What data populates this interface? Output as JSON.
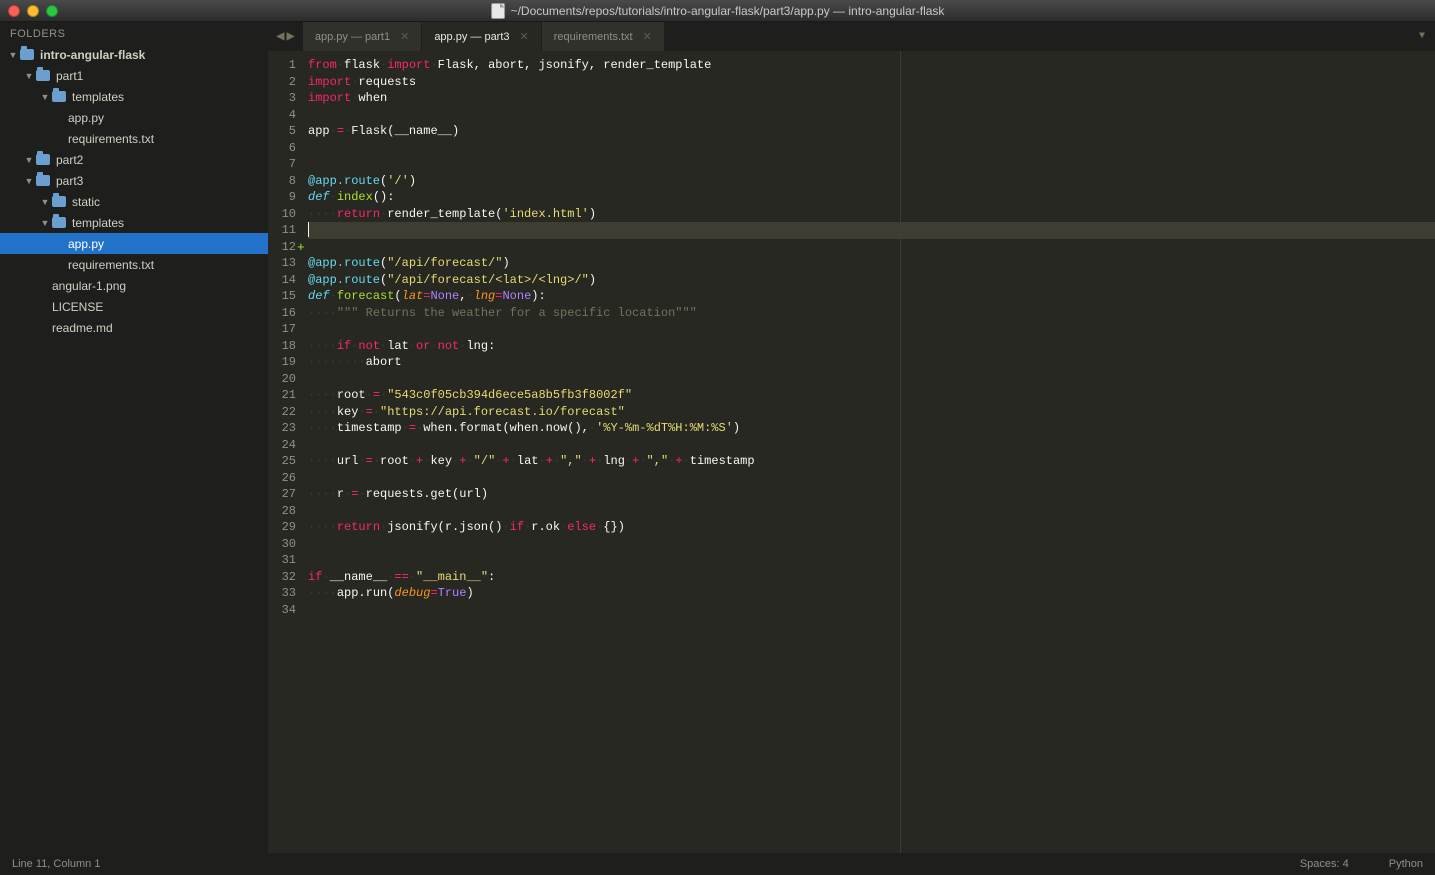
{
  "window": {
    "title": "~/Documents/repos/tutorials/intro-angular-flask/part3/app.py — intro-angular-flask"
  },
  "sidebar": {
    "header": "FOLDERS",
    "tree": [
      {
        "depth": 0,
        "type": "folder",
        "label": "intro-angular-flask",
        "bold": true
      },
      {
        "depth": 1,
        "type": "folder",
        "label": "part1"
      },
      {
        "depth": 2,
        "type": "folder",
        "label": "templates"
      },
      {
        "depth": 2,
        "type": "file",
        "label": "app.py"
      },
      {
        "depth": 2,
        "type": "file",
        "label": "requirements.txt"
      },
      {
        "depth": 1,
        "type": "folder",
        "label": "part2"
      },
      {
        "depth": 1,
        "type": "folder",
        "label": "part3"
      },
      {
        "depth": 2,
        "type": "folder",
        "label": "static"
      },
      {
        "depth": 2,
        "type": "folder",
        "label": "templates"
      },
      {
        "depth": 2,
        "type": "file",
        "label": "app.py",
        "selected": true
      },
      {
        "depth": 2,
        "type": "file",
        "label": "requirements.txt"
      },
      {
        "depth": 1,
        "type": "file",
        "label": "angular-1.png"
      },
      {
        "depth": 1,
        "type": "file",
        "label": "LICENSE"
      },
      {
        "depth": 1,
        "type": "file",
        "label": "readme.md"
      }
    ]
  },
  "tabs": [
    {
      "label": "app.py — part1",
      "active": false
    },
    {
      "label": "app.py — part3",
      "active": true
    },
    {
      "label": "requirements.txt",
      "active": false
    }
  ],
  "editor": {
    "highlighted_line": 11,
    "dirty_marker_line": 12,
    "lines": [
      [
        {
          "t": "from",
          "c": "kw"
        },
        {
          "t": " ",
          "c": "dots"
        },
        {
          "t": "flask",
          "c": "id"
        },
        {
          "t": " ",
          "c": "dots"
        },
        {
          "t": "import",
          "c": "kw"
        },
        {
          "t": " ",
          "c": "dots"
        },
        {
          "t": "Flask, abort, jsonify, render_template",
          "c": "id"
        }
      ],
      [
        {
          "t": "import",
          "c": "kw"
        },
        {
          "t": " ",
          "c": "dots"
        },
        {
          "t": "requests",
          "c": "id"
        }
      ],
      [
        {
          "t": "import",
          "c": "kw"
        },
        {
          "t": " ",
          "c": "dots"
        },
        {
          "t": "when",
          "c": "id"
        }
      ],
      [],
      [
        {
          "t": "app",
          "c": "id"
        },
        {
          "t": " ",
          "c": "dots"
        },
        {
          "t": "=",
          "c": "op"
        },
        {
          "t": " ",
          "c": "dots"
        },
        {
          "t": "Flask(",
          "c": "id"
        },
        {
          "t": "__name__",
          "c": "id"
        },
        {
          "t": ")",
          "c": "id"
        }
      ],
      [],
      [],
      [
        {
          "t": "@app.route",
          "c": "deco"
        },
        {
          "t": "(",
          "c": "id"
        },
        {
          "t": "'/'",
          "c": "decoarg"
        },
        {
          "t": ")",
          "c": "id"
        }
      ],
      [
        {
          "t": "def",
          "c": "fn"
        },
        {
          "t": " ",
          "c": "dots"
        },
        {
          "t": "index",
          "c": "fnname"
        },
        {
          "t": "():",
          "c": "id"
        }
      ],
      [
        {
          "t": "····",
          "c": "dots"
        },
        {
          "t": "return",
          "c": "kw"
        },
        {
          "t": " ",
          "c": "dots"
        },
        {
          "t": "render_template(",
          "c": "id"
        },
        {
          "t": "'index.html'",
          "c": "str"
        },
        {
          "t": ")",
          "c": "id"
        }
      ],
      [
        {
          "t": "",
          "c": "cursor-here"
        }
      ],
      [],
      [
        {
          "t": "@app.route",
          "c": "deco"
        },
        {
          "t": "(",
          "c": "id"
        },
        {
          "t": "\"/api/forecast/\"",
          "c": "decoarg"
        },
        {
          "t": ")",
          "c": "id"
        }
      ],
      [
        {
          "t": "@app.route",
          "c": "deco"
        },
        {
          "t": "(",
          "c": "id"
        },
        {
          "t": "\"/api/forecast/<lat>/<lng>/\"",
          "c": "decoarg"
        },
        {
          "t": ")",
          "c": "id"
        }
      ],
      [
        {
          "t": "def",
          "c": "fn"
        },
        {
          "t": " ",
          "c": "dots"
        },
        {
          "t": "forecast",
          "c": "fnname"
        },
        {
          "t": "(",
          "c": "id"
        },
        {
          "t": "lat",
          "c": "param"
        },
        {
          "t": "=",
          "c": "op"
        },
        {
          "t": "None",
          "c": "const"
        },
        {
          "t": ",",
          "c": "id"
        },
        {
          "t": " ",
          "c": "dots"
        },
        {
          "t": "lng",
          "c": "param"
        },
        {
          "t": "=",
          "c": "op"
        },
        {
          "t": "None",
          "c": "const"
        },
        {
          "t": "):",
          "c": "id"
        }
      ],
      [
        {
          "t": "····",
          "c": "dots"
        },
        {
          "t": "\"\"\" Returns the weather for a specific location\"\"\"",
          "c": "comment"
        }
      ],
      [],
      [
        {
          "t": "····",
          "c": "dots"
        },
        {
          "t": "if",
          "c": "kw"
        },
        {
          "t": " ",
          "c": "dots"
        },
        {
          "t": "not",
          "c": "op"
        },
        {
          "t": " ",
          "c": "dots"
        },
        {
          "t": "lat",
          "c": "id"
        },
        {
          "t": " ",
          "c": "dots"
        },
        {
          "t": "or",
          "c": "op"
        },
        {
          "t": " ",
          "c": "dots"
        },
        {
          "t": "not",
          "c": "op"
        },
        {
          "t": " ",
          "c": "dots"
        },
        {
          "t": "lng:",
          "c": "id"
        }
      ],
      [
        {
          "t": "········",
          "c": "dots"
        },
        {
          "t": "abort",
          "c": "id"
        }
      ],
      [],
      [
        {
          "t": "····",
          "c": "dots"
        },
        {
          "t": "root",
          "c": "id"
        },
        {
          "t": " ",
          "c": "dots"
        },
        {
          "t": "=",
          "c": "op"
        },
        {
          "t": " ",
          "c": "dots"
        },
        {
          "t": "\"543c0f05cb394d6ece5a8b5fb3f8002f\"",
          "c": "str"
        }
      ],
      [
        {
          "t": "····",
          "c": "dots"
        },
        {
          "t": "key",
          "c": "id"
        },
        {
          "t": " ",
          "c": "dots"
        },
        {
          "t": "=",
          "c": "op"
        },
        {
          "t": " ",
          "c": "dots"
        },
        {
          "t": "\"https://api.forecast.io/forecast\"",
          "c": "str"
        }
      ],
      [
        {
          "t": "····",
          "c": "dots"
        },
        {
          "t": "timestamp",
          "c": "id"
        },
        {
          "t": " ",
          "c": "dots"
        },
        {
          "t": "=",
          "c": "op"
        },
        {
          "t": " ",
          "c": "dots"
        },
        {
          "t": "when.format(when.now(),",
          "c": "id"
        },
        {
          "t": " ",
          "c": "dots"
        },
        {
          "t": "'%Y-%m-%dT%H:%M:%S'",
          "c": "str"
        },
        {
          "t": ")",
          "c": "id"
        }
      ],
      [],
      [
        {
          "t": "····",
          "c": "dots"
        },
        {
          "t": "url",
          "c": "id"
        },
        {
          "t": " ",
          "c": "dots"
        },
        {
          "t": "=",
          "c": "op"
        },
        {
          "t": " ",
          "c": "dots"
        },
        {
          "t": "root",
          "c": "id"
        },
        {
          "t": " ",
          "c": "dots"
        },
        {
          "t": "+",
          "c": "op"
        },
        {
          "t": " ",
          "c": "dots"
        },
        {
          "t": "key",
          "c": "id"
        },
        {
          "t": " ",
          "c": "dots"
        },
        {
          "t": "+",
          "c": "op"
        },
        {
          "t": " ",
          "c": "dots"
        },
        {
          "t": "\"/\"",
          "c": "str"
        },
        {
          "t": " ",
          "c": "dots"
        },
        {
          "t": "+",
          "c": "op"
        },
        {
          "t": " ",
          "c": "dots"
        },
        {
          "t": "lat",
          "c": "id"
        },
        {
          "t": " ",
          "c": "dots"
        },
        {
          "t": "+",
          "c": "op"
        },
        {
          "t": " ",
          "c": "dots"
        },
        {
          "t": "\",\"",
          "c": "str"
        },
        {
          "t": " ",
          "c": "dots"
        },
        {
          "t": "+",
          "c": "op"
        },
        {
          "t": " ",
          "c": "dots"
        },
        {
          "t": "lng",
          "c": "id"
        },
        {
          "t": " ",
          "c": "dots"
        },
        {
          "t": "+",
          "c": "op"
        },
        {
          "t": " ",
          "c": "dots"
        },
        {
          "t": "\",\"",
          "c": "str"
        },
        {
          "t": " ",
          "c": "dots"
        },
        {
          "t": "+",
          "c": "op"
        },
        {
          "t": " ",
          "c": "dots"
        },
        {
          "t": "timestamp",
          "c": "id"
        }
      ],
      [],
      [
        {
          "t": "····",
          "c": "dots"
        },
        {
          "t": "r",
          "c": "id"
        },
        {
          "t": " ",
          "c": "dots"
        },
        {
          "t": "=",
          "c": "op"
        },
        {
          "t": " ",
          "c": "dots"
        },
        {
          "t": "requests.get(url)",
          "c": "id"
        }
      ],
      [],
      [
        {
          "t": "····",
          "c": "dots"
        },
        {
          "t": "return",
          "c": "kw"
        },
        {
          "t": " ",
          "c": "dots"
        },
        {
          "t": "jsonify(r.json()",
          "c": "id"
        },
        {
          "t": " ",
          "c": "dots"
        },
        {
          "t": "if",
          "c": "kw"
        },
        {
          "t": " ",
          "c": "dots"
        },
        {
          "t": "r.ok",
          "c": "id"
        },
        {
          "t": " ",
          "c": "dots"
        },
        {
          "t": "else",
          "c": "kw"
        },
        {
          "t": " ",
          "c": "dots"
        },
        {
          "t": "{})",
          "c": "id"
        }
      ],
      [],
      [],
      [
        {
          "t": "if",
          "c": "kw"
        },
        {
          "t": " ",
          "c": "dots"
        },
        {
          "t": "__name__",
          "c": "id"
        },
        {
          "t": " ",
          "c": "dots"
        },
        {
          "t": "==",
          "c": "op"
        },
        {
          "t": " ",
          "c": "dots"
        },
        {
          "t": "\"__main__\"",
          "c": "str"
        },
        {
          "t": ":",
          "c": "id"
        }
      ],
      [
        {
          "t": "····",
          "c": "dots"
        },
        {
          "t": "app.run(",
          "c": "id"
        },
        {
          "t": "debug",
          "c": "param"
        },
        {
          "t": "=",
          "c": "op"
        },
        {
          "t": "True",
          "c": "const"
        },
        {
          "t": ")",
          "c": "id"
        }
      ],
      []
    ]
  },
  "statusbar": {
    "left": "Line 11, Column 1",
    "spaces": "Spaces: 4",
    "lang": "Python"
  }
}
